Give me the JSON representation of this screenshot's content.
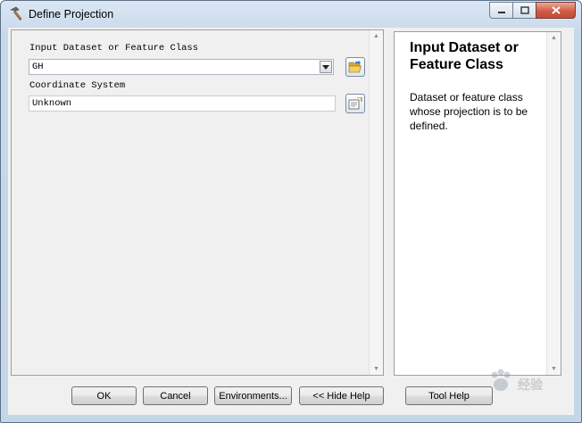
{
  "window": {
    "title": "Define Projection",
    "icons": {
      "app": "hammer-icon",
      "minimize": "minimize-icon",
      "maximize": "maximize-icon",
      "close": "close-icon"
    }
  },
  "params": {
    "input_label": "Input Dataset or Feature Class",
    "input_value": "GH",
    "coord_label": "Coordinate System",
    "coord_value": "Unknown",
    "icons": {
      "browse": "open-folder-icon",
      "properties": "coordinate-properties-icon",
      "dropdown": "chevron-down-icon"
    }
  },
  "help": {
    "title": "Input Dataset or Feature Class",
    "body": "Dataset or feature class whose projection is to be defined."
  },
  "buttons": {
    "ok": "OK",
    "cancel": "Cancel",
    "environments": "Environments...",
    "hide_help": "<< Hide Help",
    "tool_help": "Tool Help"
  },
  "watermark": {
    "text": "经验"
  }
}
